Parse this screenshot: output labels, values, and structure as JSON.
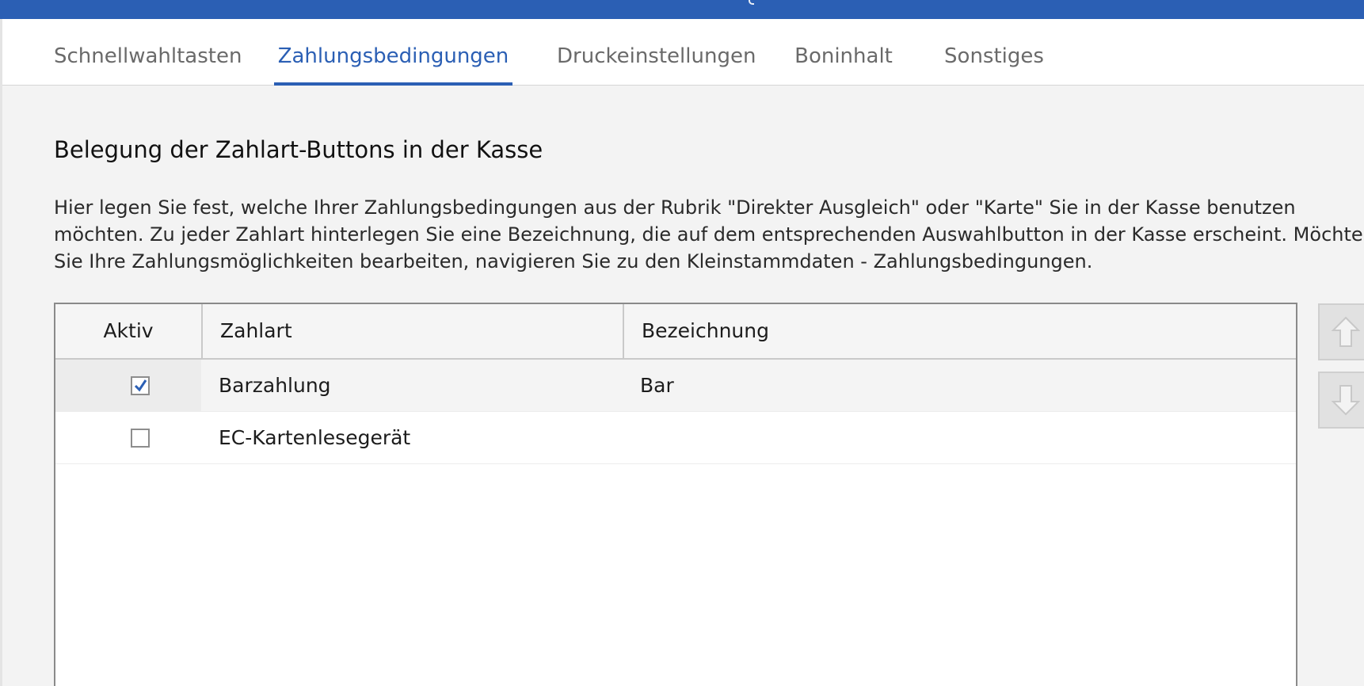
{
  "tabs": [
    {
      "label": "Schnellwahltasten",
      "active": false
    },
    {
      "label": "Zahlungsbedingungen",
      "active": true
    },
    {
      "label": "Druckeinstellungen",
      "active": false
    },
    {
      "label": "Boninhalt",
      "active": false
    },
    {
      "label": "Sonstiges",
      "active": false
    }
  ],
  "section": {
    "title": "Belegung der Zahlart-Buttons in der Kasse",
    "description_lines": [
      "Hier legen Sie fest, welche Ihrer Zahlungsbedingungen aus der Rubrik \"Direkter Ausgleich\" oder \"Karte\" Sie in der Kasse benutzen",
      "möchten. Zu jeder Zahlart hinterlegen Sie eine Bezeichnung, die auf dem entsprechenden Auswahlbutton in der Kasse erscheint. Möchten",
      "Sie Ihre Zahlungsmöglichkeiten bearbeiten, navigieren Sie zu den Kleinstammdaten - Zahlungsbedingungen."
    ]
  },
  "table": {
    "columns": [
      "Aktiv",
      "Zahlart",
      "Bezeichnung"
    ],
    "rows": [
      {
        "aktiv": true,
        "zahlart": "Barzahlung",
        "bezeichnung": "Bar",
        "selected": true
      },
      {
        "aktiv": false,
        "zahlart": "EC-Kartenlesegerät",
        "bezeichnung": "",
        "selected": false
      }
    ]
  },
  "side_buttons": {
    "up_icon": "arrow-up-icon",
    "down_icon": "arrow-down-icon"
  },
  "colors": {
    "accent": "#2b5fb4",
    "checkmark": "#2b5fb4"
  }
}
